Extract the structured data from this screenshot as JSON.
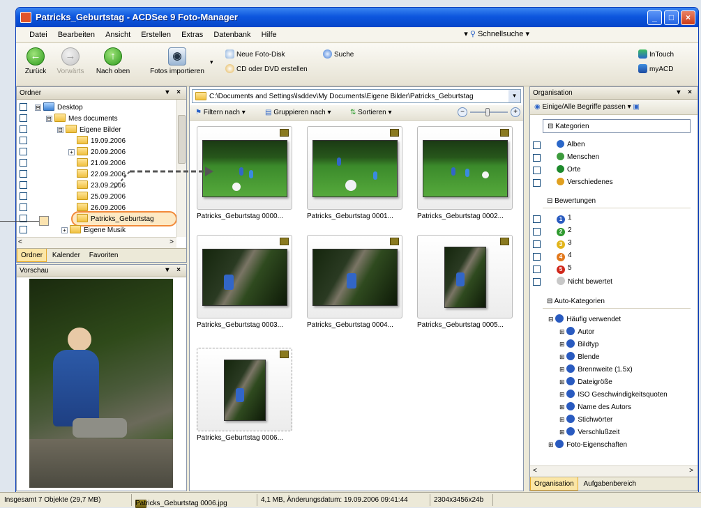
{
  "window": {
    "title": "Patricks_Geburtstag - ACDSee 9 Foto-Manager",
    "min_label": "_",
    "max_label": "□",
    "close_label": "×"
  },
  "menu": {
    "items": [
      "Datei",
      "Bearbeiten",
      "Ansicht",
      "Erstellen",
      "Extras",
      "Datenbank",
      "Hilfe"
    ],
    "quick_search_label": "Schnellsuche"
  },
  "toolbar": {
    "back": "Zurück",
    "forward": "Vorwärts",
    "up": "Nach oben",
    "import": "Fotos importieren",
    "new_disc": "Neue Foto-Disk",
    "burn_cd": "CD oder DVD erstellen",
    "search": "Suche",
    "intouch": "InTouch",
    "myacd": "myACD"
  },
  "folders_pane": {
    "title": "Ordner",
    "controls": "▾ ×",
    "tree": [
      {
        "label": "Desktop",
        "exp": "⊟"
      },
      {
        "label": "Mes documents",
        "exp": "⊟"
      },
      {
        "label": "Eigene Bilder",
        "exp": "⊟"
      },
      {
        "label": "19.09.2006",
        "exp": ""
      },
      {
        "label": "20.09.2006",
        "exp": "+"
      },
      {
        "label": "21.09.2006",
        "exp": ""
      },
      {
        "label": "22.09.2006",
        "exp": ""
      },
      {
        "label": "23.09.2006",
        "exp": ""
      },
      {
        "label": "25.09.2006",
        "exp": ""
      },
      {
        "label": "26.09.2006",
        "exp": ""
      },
      {
        "label": "Patricks_Geburtstag",
        "exp": ""
      },
      {
        "label": "Eigene Musik",
        "exp": "+"
      }
    ],
    "tabs": [
      "Ordner",
      "Kalender",
      "Favoriten"
    ]
  },
  "preview_pane": {
    "title": "Vorschau",
    "controls": "▾ ×"
  },
  "browser": {
    "path": "C:\\Documents and Settings\\lsddev\\My Documents\\Eigene Bilder\\Patricks_Geburtstag",
    "filter_label": "Filtern nach",
    "group_label": "Gruppieren nach",
    "sort_label": "Sortieren",
    "zoom_minus": "−",
    "zoom_plus": "+",
    "thumbnails": [
      {
        "caption": "Patricks_Geburtstag 0000..."
      },
      {
        "caption": "Patricks_Geburtstag 0001..."
      },
      {
        "caption": "Patricks_Geburtstag 0002..."
      },
      {
        "caption": "Patricks_Geburtstag 0003..."
      },
      {
        "caption": "Patricks_Geburtstag 0004..."
      },
      {
        "caption": "Patricks_Geburtstag 0005..."
      },
      {
        "caption": "Patricks_Geburtstag 0006..."
      }
    ]
  },
  "organisation": {
    "title": "Organisation",
    "controls": "▾ ×",
    "match_label": "Einige/Alle Begriffe passen",
    "categories_header": "Kategorien",
    "categories": [
      "Alben",
      "Menschen",
      "Orte",
      "Verschiedenes"
    ],
    "ratings_header": "Bewertungen",
    "ratings": [
      {
        "num": "1",
        "label": "1"
      },
      {
        "num": "2",
        "label": "2"
      },
      {
        "num": "3",
        "label": "3"
      },
      {
        "num": "4",
        "label": "4"
      },
      {
        "num": "5",
        "label": "5"
      },
      {
        "num": "",
        "label": "Nicht bewertet"
      }
    ],
    "auto_header": "Auto-Kategorien",
    "auto_root": "Häufig verwendet",
    "auto_items": [
      "Autor",
      "Bildtyp",
      "Blende",
      "Brennweite (1.5x)",
      "Dateigröße",
      "ISO Geschwindigkeitsquoten",
      "Name des Autors",
      "Stichwörter",
      "Verschlußzeit"
    ],
    "auto_root2": "Foto-Eigenschaften",
    "tabs": [
      "Organisation",
      "Aufgabenbereich"
    ]
  },
  "status": {
    "total": "Insgesamt 7 Objekte (29,7 MB)",
    "file": "Patricks_Geburtstag 0006.jpg",
    "info": "4,1 MB, Änderungsdatum: 19.09.2006 09:41:44",
    "dims": "2304x3456x24b"
  }
}
